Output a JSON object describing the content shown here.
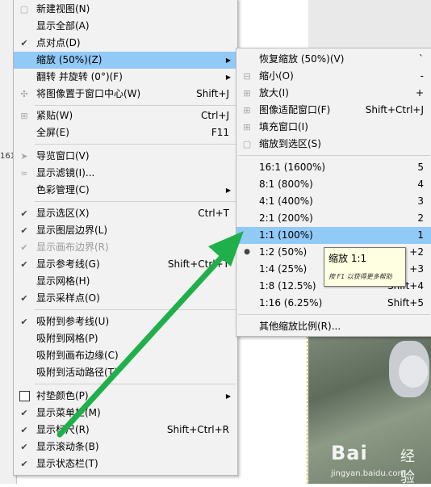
{
  "background": {
    "left_number": "161"
  },
  "view_menu": {
    "items": [
      {
        "label": "新建视图(N)",
        "icon": "new-view-icon"
      },
      {
        "label": "显示全部(A)"
      },
      {
        "label": "点对点(D)",
        "checked": true
      },
      {
        "label": "缩放 (50%)(Z)",
        "submenu": true,
        "highlighted": true
      },
      {
        "label": "翻转 并旋转 (0°)(F)",
        "submenu": true
      },
      {
        "label": "将图像置于窗口中心(W)",
        "shortcut": "Shift+J",
        "icon": "center-image-icon"
      },
      {
        "label": "紧贴(W)",
        "shortcut": "Ctrl+J",
        "icon": "shrink-wrap-icon"
      },
      {
        "label": "全屏(E)",
        "shortcut": "F11"
      },
      {
        "label": "导览窗口(V)",
        "icon": "navigate-icon"
      },
      {
        "label": "显示滤镜(I)...",
        "icon": "display-filters-icon"
      },
      {
        "label": "色彩管理(C)",
        "submenu": true
      },
      {
        "label": "显示选区(X)",
        "shortcut": "Ctrl+T",
        "checked": true
      },
      {
        "label": "显示图层边界(L)",
        "checked": true
      },
      {
        "label": "显示画布边界(R)",
        "checked": true,
        "disabled": true
      },
      {
        "label": "显示参考线(G)",
        "shortcut": "Shift+Ctrl+T",
        "checked": true
      },
      {
        "label": "显示网格(H)"
      },
      {
        "label": "显示采样点(O)",
        "checked": true
      },
      {
        "label": "吸附到参考线(U)",
        "checked": true
      },
      {
        "label": "吸附到网格(P)"
      },
      {
        "label": "吸附到画布边缘(C)"
      },
      {
        "label": "吸附到活动路径(T)"
      },
      {
        "label": "衬垫颜色(P)",
        "submenu": true,
        "checkbox_icon": true
      },
      {
        "label": "显示菜单栏(M)",
        "checked": true
      },
      {
        "label": "显示标尺(R)",
        "shortcut": "Shift+Ctrl+R",
        "checked": true
      },
      {
        "label": "显示滚动条(B)",
        "checked": true
      },
      {
        "label": "显示状态栏(T)",
        "checked": true
      }
    ]
  },
  "zoom_submenu": {
    "items": [
      {
        "label": "恢复缩放 (50%)(V)",
        "shortcut": "`"
      },
      {
        "label": "缩小(O)",
        "shortcut": "-",
        "icon": "zoom-out-icon"
      },
      {
        "label": "放大(I)",
        "shortcut": "+",
        "icon": "zoom-in-icon"
      },
      {
        "label": "图像适配窗口(F)",
        "shortcut": "Shift+Ctrl+J",
        "icon": "fit-image-icon"
      },
      {
        "label": "填充窗口(I)",
        "icon": "fill-window-icon"
      },
      {
        "label": "缩放到选区(S)",
        "icon": "zoom-selection-icon"
      },
      {
        "label": "16:1  (1600%)",
        "shortcut": "5"
      },
      {
        "label": "8:1  (800%)",
        "shortcut": "4"
      },
      {
        "label": "4:1  (400%)",
        "shortcut": "3"
      },
      {
        "label": "2:1  (200%)",
        "shortcut": "2"
      },
      {
        "label": "1:1  (100%)",
        "shortcut": "1",
        "highlighted": true
      },
      {
        "label": "1:2  (50%)",
        "shortcut": "+2",
        "selected": true
      },
      {
        "label": "1:4  (25%)",
        "shortcut": "+3"
      },
      {
        "label": "1:8  (12.5%)",
        "shortcut": "Shift+4"
      },
      {
        "label": "1:16  (6.25%)",
        "shortcut": "Shift+5"
      },
      {
        "label": "其他缩放比例(R)..."
      }
    ]
  },
  "tooltip": {
    "title": "缩放 1:1",
    "hint": "按 F1 以获得更多帮助"
  },
  "watermark": {
    "brand": "Bai",
    "brand_cn": "经验",
    "url": "jingyan.baidu.com"
  },
  "colors": {
    "highlight": "#91c9f7",
    "arrow": "#20b04b",
    "tooltip_bg": "#ffffe1"
  }
}
